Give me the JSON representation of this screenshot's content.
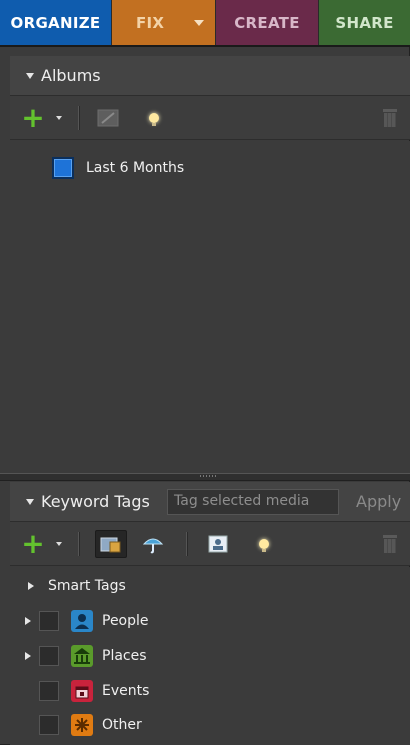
{
  "tabs": [
    {
      "label": "ORGANIZE"
    },
    {
      "label": "FIX"
    },
    {
      "label": "CREATE"
    },
    {
      "label": "SHARE"
    }
  ],
  "albums": {
    "title": "Albums",
    "items": [
      {
        "label": "Last 6 Months"
      }
    ]
  },
  "keyword_tags": {
    "title": "Keyword Tags",
    "input_placeholder": "Tag selected media",
    "apply_label": "Apply",
    "smart_tags_label": "Smart Tags",
    "categories": [
      {
        "label": "People",
        "color": "#2a86c8",
        "icon": "people-icon",
        "expandable": true
      },
      {
        "label": "Places",
        "color": "#5a9b2b",
        "icon": "places-icon",
        "expandable": true
      },
      {
        "label": "Events",
        "color": "#c8233c",
        "icon": "events-icon",
        "expandable": false
      },
      {
        "label": "Other",
        "color": "#e07b12",
        "icon": "other-icon",
        "expandable": false
      }
    ]
  },
  "colors": {
    "organize": "#0f5cae",
    "fix": "#c27021",
    "create": "#6a2a4a",
    "share": "#3b6a33",
    "panel_bg": "#3b3b3b"
  }
}
